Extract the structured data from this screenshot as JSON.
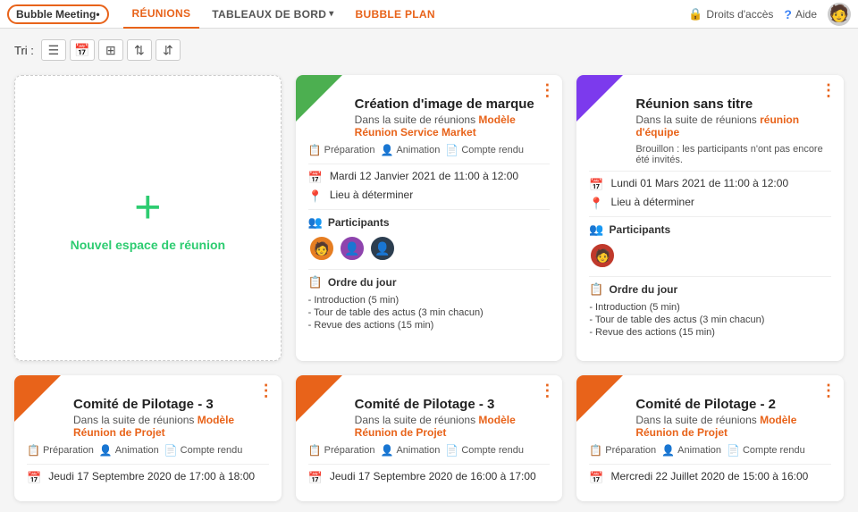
{
  "navbar": {
    "brand": "Bubble Meeting",
    "nav_items": [
      {
        "id": "reunions",
        "label": "RÉUNIONS",
        "active": true
      },
      {
        "id": "tableaux",
        "label": "TABLEAUX DE BORD",
        "hasArrow": true
      },
      {
        "id": "bubbleplan",
        "label": "BUBBLE PLAN",
        "highlight": true
      }
    ],
    "droits": "Droits d'accès",
    "aide": "Aide"
  },
  "sort": {
    "label": "Tri :"
  },
  "cards": [
    {
      "id": "new",
      "type": "new",
      "plus": "+",
      "label": "Nouvel espace de réunion"
    },
    {
      "id": "card1",
      "type": "regular",
      "corner": "green",
      "title": "Création d'image de marque",
      "subtitle_prefix": "Dans la suite de réunions",
      "subtitle_link": "Modèle Réunion Service Market",
      "statuses": [
        {
          "type": "prep",
          "icon": "📋",
          "label": "Préparation"
        },
        {
          "type": "anim",
          "icon": "👤",
          "label": "Animation"
        },
        {
          "type": "cr",
          "icon": "📄",
          "label": "Compte rendu"
        }
      ],
      "date": "Mardi 12 Janvier 2021 de 11:00 à 12:00",
      "location": "Lieu à déterminer",
      "participants_title": "Participants",
      "participants": [
        "👤",
        "👤",
        "👤"
      ],
      "agenda_title": "Ordre du jour",
      "agenda_items": [
        "- Introduction (5 min)",
        "- Tour de table des actus (3 min chacun)",
        "- Revue des actions (15 min)"
      ]
    },
    {
      "id": "card2",
      "type": "regular",
      "corner": "purple",
      "title": "Réunion sans titre",
      "subtitle_prefix": "Dans la suite de réunions",
      "subtitle_link": "réunion d'équipe",
      "subtitle_link_color": "purple",
      "note": "Brouillon : les participants n'ont pas encore été invités.",
      "statuses": [],
      "date": "Lundi 01 Mars 2021 de 11:00 à 12:00",
      "location": "Lieu à déterminer",
      "participants_title": "Participants",
      "participants": [
        "👤"
      ],
      "agenda_title": "Ordre du jour",
      "agenda_items": [
        "- Introduction (5 min)",
        "- Tour de table des actus (3 min chacun)",
        "- Revue des actions (15 min)"
      ]
    }
  ],
  "bottom_cards": [
    {
      "id": "bc1",
      "corner": "orange",
      "title": "Comité de Pilotage - 3",
      "subtitle_prefix": "Dans la suite de réunions",
      "subtitle_link": "Modèle Réunion de Projet",
      "statuses": [
        {
          "type": "prep",
          "label": "Préparation"
        },
        {
          "type": "anim",
          "label": "Animation"
        },
        {
          "type": "cr",
          "label": "Compte rendu"
        }
      ],
      "date": "Jeudi 17 Septembre 2020 de 17:00 à 18:00"
    },
    {
      "id": "bc2",
      "corner": "orange",
      "title": "Comité de Pilotage - 3",
      "subtitle_prefix": "Dans la suite de réunions",
      "subtitle_link": "Modèle Réunion de Projet",
      "statuses": [
        {
          "type": "prep",
          "label": "Préparation"
        },
        {
          "type": "anim",
          "label": "Animation"
        },
        {
          "type": "cr",
          "label": "Compte rendu"
        }
      ],
      "date": "Jeudi 17 Septembre 2020 de 16:00 à 17:00"
    },
    {
      "id": "bc3",
      "corner": "orange",
      "title": "Comité de Pilotage - 2",
      "subtitle_prefix": "Dans la suite de réunions",
      "subtitle_link": "Modèle Réunion de Projet",
      "statuses": [
        {
          "type": "prep",
          "label": "Préparation"
        },
        {
          "type": "anim",
          "label": "Animation"
        },
        {
          "type": "cr",
          "label": "Compte rendu"
        }
      ],
      "date": "Mercredi 22 Juillet 2020 de 15:00 à 16:00"
    }
  ]
}
